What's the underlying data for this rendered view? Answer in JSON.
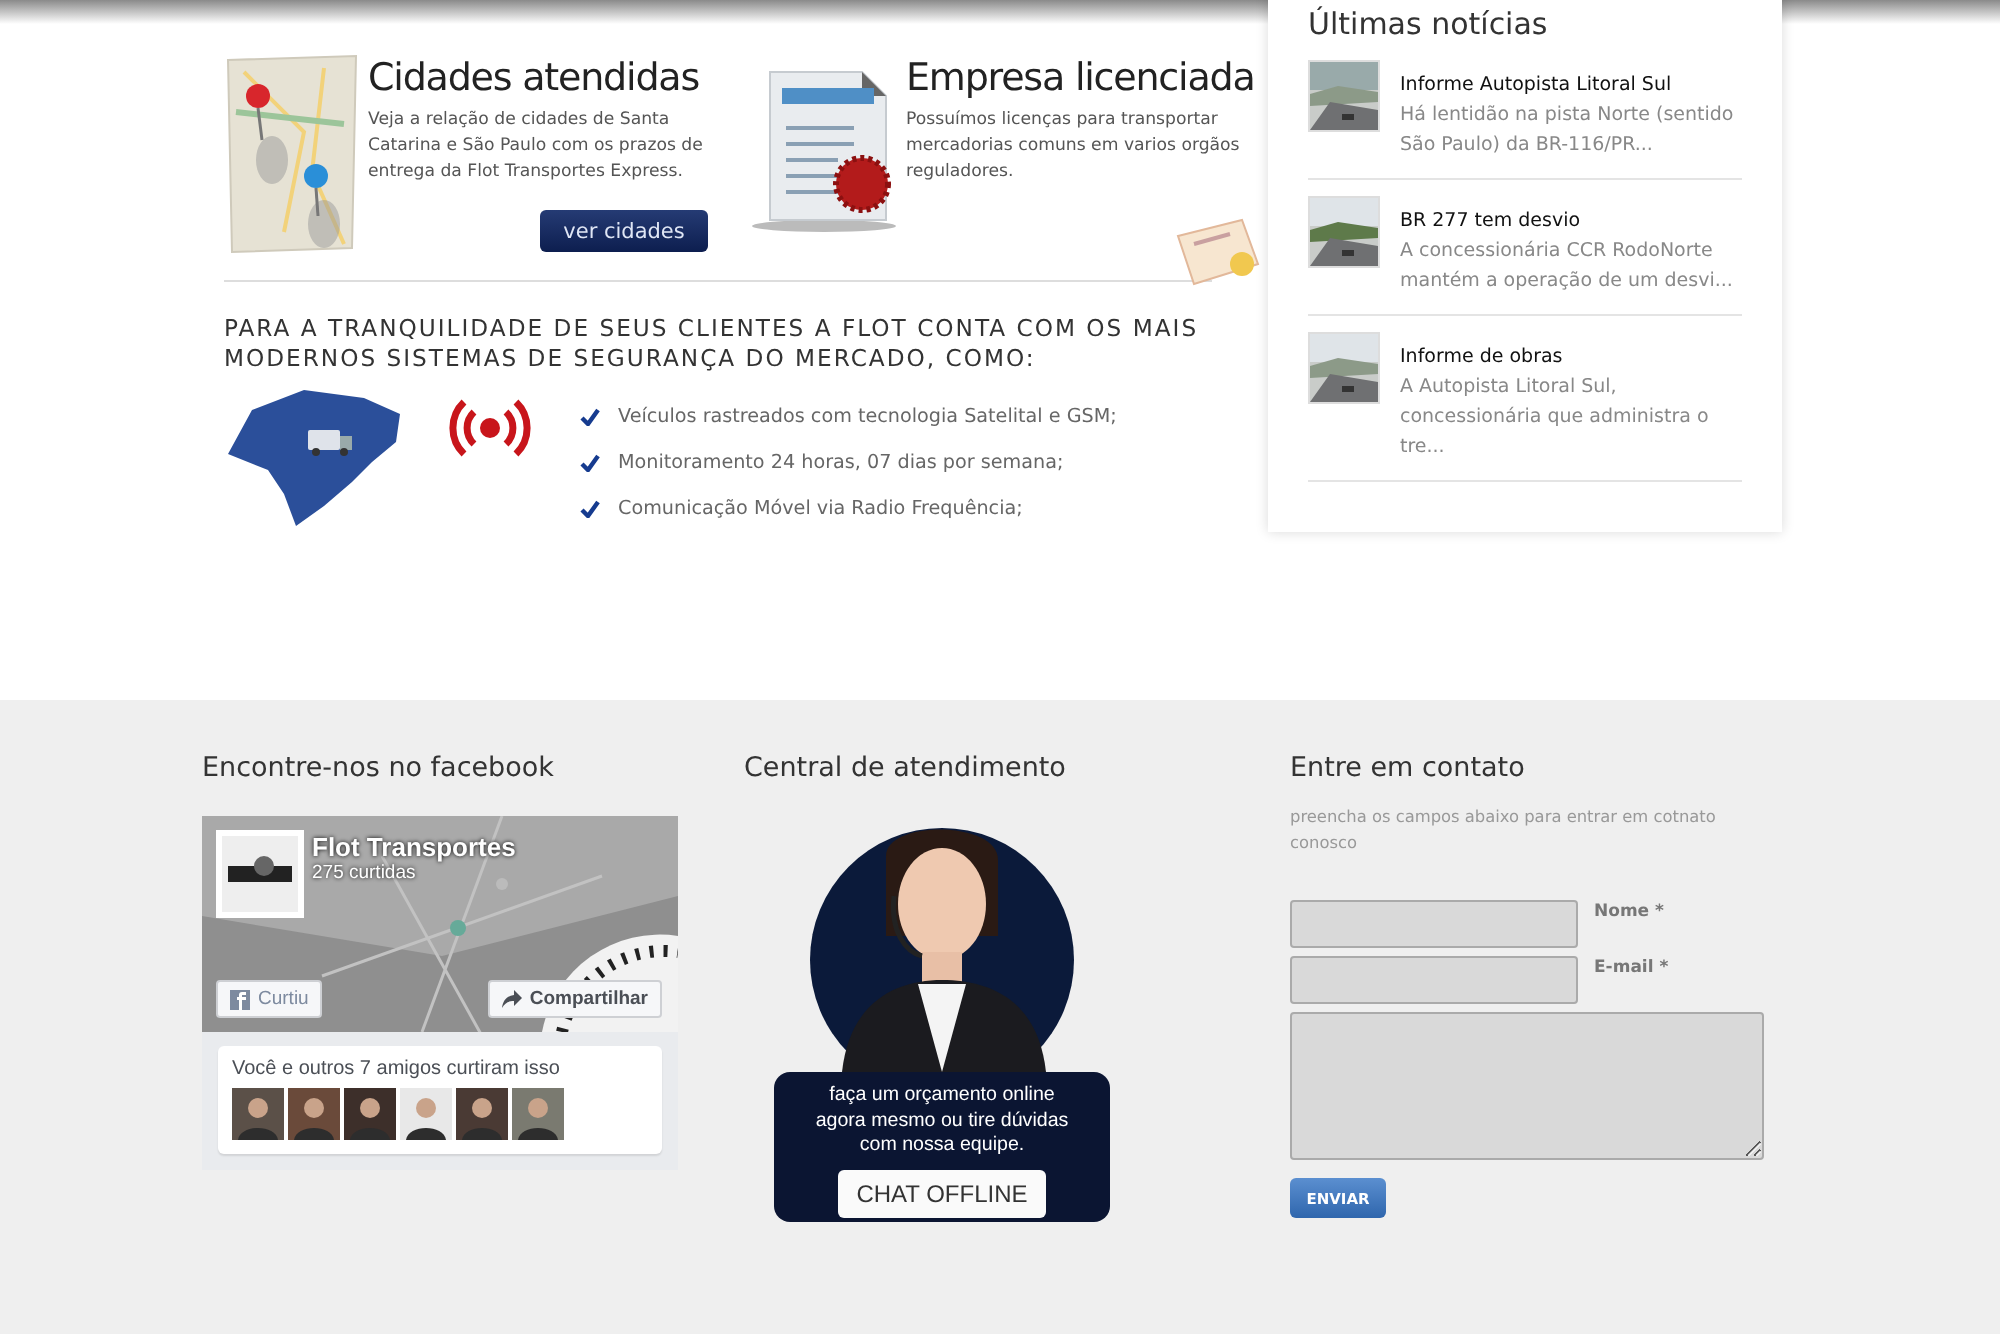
{
  "features": [
    {
      "kind": "map",
      "title": "Cidades atendidas",
      "text": "Veja a relação de cidades de Santa Catarina e São Paulo com os prazos de entrega da Flot Transportes Express.",
      "button": "ver cidades"
    },
    {
      "kind": "license",
      "title": "Empresa licenciada",
      "text": "Possuímos licenças para transportar mercadorias comuns em varios orgãos reguladores."
    }
  ],
  "security": {
    "heading": "PARA A TRANQUILIDADE DE SEUS CLIENTES A FLOT CONTA COM OS MAIS MODERNOS SISTEMAS DE SEGURANÇA DO MERCADO, COMO:",
    "items": [
      "Veículos rastreados com tecnologia Satelital e GSM;",
      "Monitoramento 24 horas, 07 dias por semana;",
      "Comunicação Móvel via Radio Frequência;"
    ]
  },
  "news": {
    "title": "Últimas notícias",
    "items": [
      {
        "title": "Informe Autopista Litoral Sul",
        "summary": "Há lentidão na pista Norte (sentido São Paulo) da BR-116/PR..."
      },
      {
        "title": "BR 277 tem desvio",
        "summary": "A concessionária CCR RodoNorte mantém a operação de um desvi..."
      },
      {
        "title": "Informe de obras",
        "summary": "A Autopista Litoral Sul, concessionária que administra o tre..."
      }
    ]
  },
  "facebook": {
    "title": "Encontre-nos no facebook",
    "page_name": "Flot Transportes",
    "likes": "275 curtidas",
    "like_button": "Curtiu",
    "share_button": "Compartilhar",
    "friends_text": "Você e outros 7 amigos curtiram isso"
  },
  "chat": {
    "title": "Central de atendimento",
    "message": "faça um orçamento online agora mesmo ou tire dúvidas com nossa equipe.",
    "button": "CHAT OFFLINE"
  },
  "contact": {
    "title": "Entre em contato",
    "hint": "preencha os campos abaixo para entrar em cotnato conosco",
    "fields": [
      {
        "label": "Nome *"
      },
      {
        "label": "E-mail *"
      }
    ],
    "button": "ENVIAR"
  }
}
